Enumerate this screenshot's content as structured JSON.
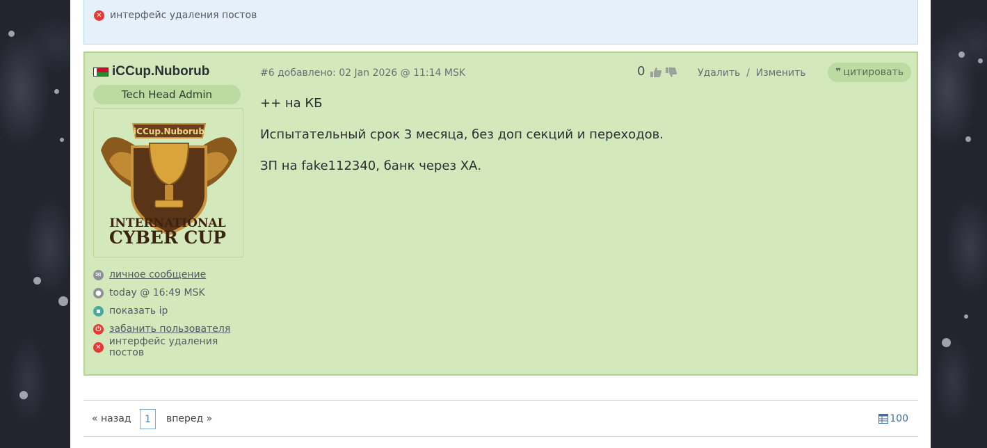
{
  "prev_post": {
    "delete_posts_link": "интерфейс удаления постов"
  },
  "post": {
    "username": "iCCup.Nuborub",
    "role": "Tech Head Admin",
    "avatar": {
      "top_text": "iCCup.Nuborub",
      "bottom_text_1": "INTERNATIONAL",
      "bottom_text_2": "CYBER CUP"
    },
    "links": {
      "pm": "личное сообщение",
      "last_seen": "today @ 16:49 MSK",
      "show_ip": "показать ip",
      "ban_user": "забанить пользователя",
      "delete_posts": "интерфейс удаления постов"
    },
    "meta": "#6 добавлено: 02 Jan 2026 @ 11:14 MSK",
    "score": "0",
    "delete_label": "Удалить",
    "separator": "/",
    "edit_label": "Изменить",
    "quote_label": "цитировать",
    "body": [
      "++ на КБ",
      "Испытательный срок 3 месяца, без доп секций и переходов.",
      "ЗП на fake112340, банк через ХА."
    ]
  },
  "pager": {
    "prev_label": "« назад",
    "current_page": "1",
    "next_label": "вперед »",
    "per_page": "100"
  },
  "colors": {
    "post_bg": "#d3e8bb",
    "prev_post_bg": "#e6f0fa",
    "accent_red": "#e53935"
  }
}
